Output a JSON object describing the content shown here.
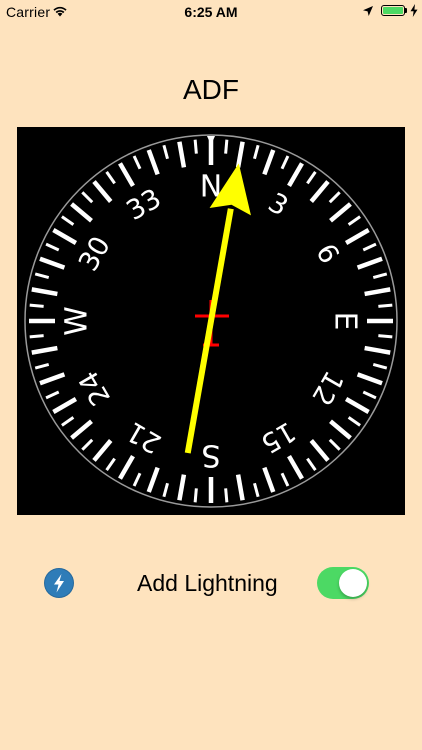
{
  "status_bar": {
    "carrier": "Carrier",
    "time": "6:25 AM"
  },
  "title": "ADF",
  "compass": {
    "cardinals": {
      "north": "N",
      "east": "E",
      "south": "S",
      "west": "W"
    },
    "numerals": {
      "n3": "3",
      "n6": "6",
      "n12": "12",
      "n15": "15",
      "n21": "21",
      "n24": "24",
      "n30": "30",
      "n33": "33"
    },
    "needle_heading_deg": 10,
    "needle_color": "#FFFF00",
    "center_mark_color": "#FF0000"
  },
  "lightning_icon": "lightning-icon",
  "toggle": {
    "label": "Add Lightning",
    "on": true,
    "on_color": "#4CD964"
  },
  "colors": {
    "background": "#FEE3BE",
    "dial_background": "#000000",
    "button_blue": "#2E7CB8"
  }
}
